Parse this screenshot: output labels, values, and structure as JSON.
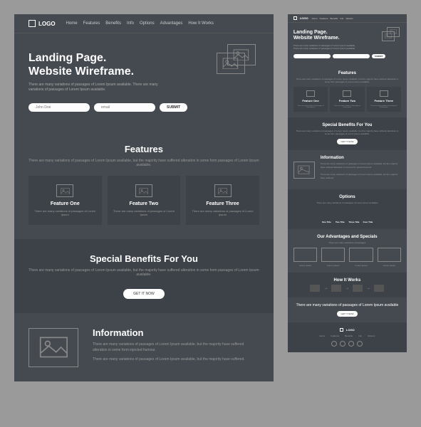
{
  "logo": "LOGO",
  "nav": [
    "Home",
    "Features",
    "Benefits",
    "Info",
    "Options",
    "Advantages",
    "How It Works"
  ],
  "hero": {
    "title1": "Landing Page.",
    "title2": "Website Wireframe.",
    "desc": "There are many variations of passages of Lorem Ipsum available. There are many variations of passages of Lorem Ipsum available.",
    "name_ph": "John Doe",
    "email_ph": "email",
    "submit": "SUBMIT"
  },
  "features": {
    "title": "Features",
    "sub": "There are many variations of passages of Lorem Ipsum available, but the majority have suffered alteration in some form passages of Lorem Ipsum available.",
    "items": [
      {
        "title": "Feature One",
        "desc": "There are many variations of passages of Lorem Ipsum"
      },
      {
        "title": "Feature Two",
        "desc": "There are many variations of passages of Lorem Ipsum"
      },
      {
        "title": "Feature Three",
        "desc": "There are many variations of passages of Lorem Ipsum"
      }
    ]
  },
  "benefits": {
    "title": "Special Benefits For You",
    "sub": "There are many variations of passages of Lorem Ipsum available, but the majority have suffered alteration in some form passages of Lorem Ipsum available.",
    "cta": "GET IT NOW"
  },
  "info": {
    "title": "Information",
    "p1": "There are many variations of passages of Lorem Ipsum available, but the majority have suffered alteration in some form injected humour.",
    "p2": "There are many variations of passages of Lorem Ipsum available, but the majority have suffered."
  },
  "options": {
    "title": "Options",
    "sub": "There are many variations of passages of Lorem Ipsum available",
    "items": [
      {
        "title": "One Title"
      },
      {
        "title": "Two Title"
      },
      {
        "title": "Three Title"
      },
      {
        "title": "Four Title"
      }
    ]
  },
  "advantages": {
    "title": "Our Advantages and Specials",
    "sub": "There are many variations of passages"
  },
  "how": {
    "title": "How It Works"
  },
  "cta2": {
    "text": "There are many variations of passages of Lorem Ipsum available"
  }
}
